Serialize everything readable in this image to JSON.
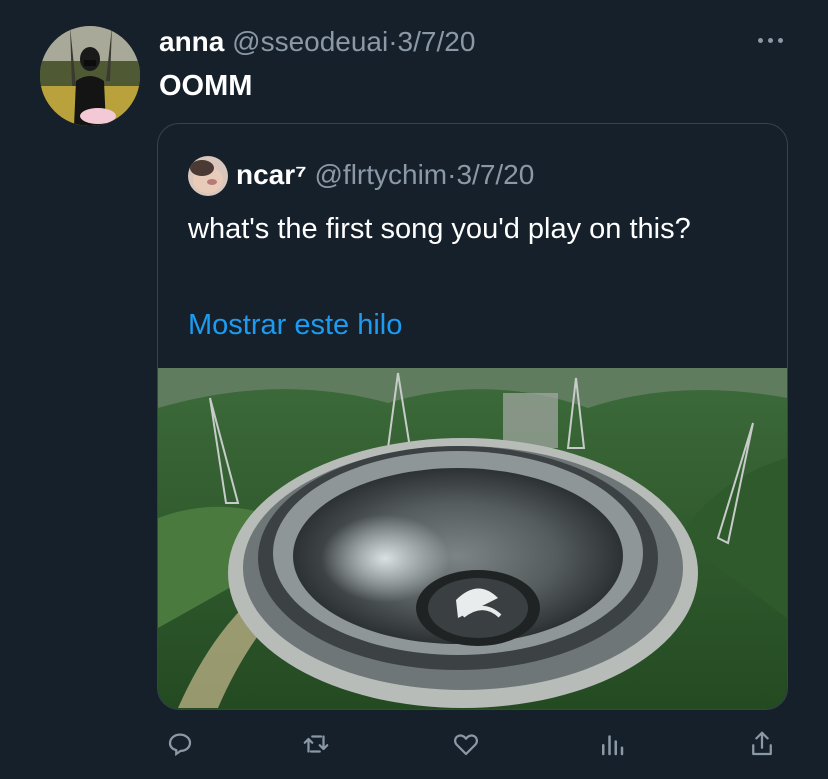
{
  "tweet": {
    "author_name": "anna",
    "author_handle": "@sseodeuai",
    "separator": "·",
    "date": "3/7/20",
    "text": "OOMM"
  },
  "quoted_tweet": {
    "author_name": "ncar⁷",
    "author_handle": "@flrtychim",
    "separator": "·",
    "date": "3/7/20",
    "text": "what's the first song you'd play on this?",
    "show_thread_link": "Mostrar este hilo"
  },
  "actions": {
    "reply_icon": "reply-icon",
    "retweet_icon": "retweet-icon",
    "like_icon": "heart-icon",
    "stats_icon": "analytics-icon",
    "share_icon": "share-icon"
  },
  "colors": {
    "background": "#15202b",
    "muted": "#8b98a5",
    "link": "#1d9bf0",
    "border": "#38444d"
  }
}
